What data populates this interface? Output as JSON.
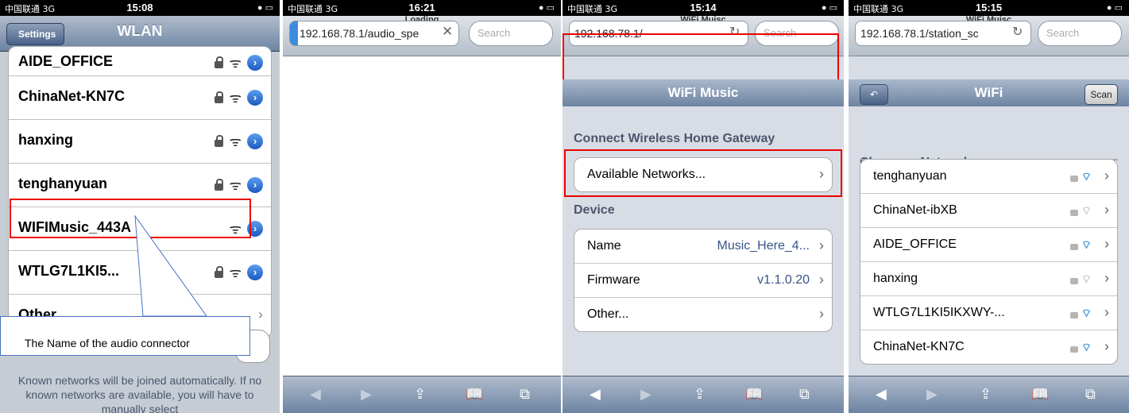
{
  "p1": {
    "status": {
      "carrier": "中国联通 3G",
      "time": "15:08"
    },
    "back": "Settings",
    "title": "WLAN",
    "networks": [
      "AIDE_OFFICE",
      "ChinaNet-KN7C",
      "hanxing",
      "tenghanyuan",
      "WIFIMusic_443A",
      "WTLG7L1KI5..."
    ],
    "other": "Other...",
    "callout": "The Name of the audio connector",
    "footnote": "Known networks will be joined automatically. If no known networks are available, you will have to manually select"
  },
  "p2": {
    "status": {
      "carrier": "中国联通 3G",
      "time": "16:21"
    },
    "page_title": "Loading",
    "url": "192.168.78.1/audio_spe",
    "search_placeholder": "Search"
  },
  "p3": {
    "status": {
      "carrier": "中国联通 3G",
      "time": "15:14"
    },
    "page_title": "WiFi Muisc",
    "url": "192.168.78.1/",
    "search_placeholder": "Search",
    "header": "WiFi Music",
    "section1": "Connect Wireless Home Gateway",
    "available": "Available Networks...",
    "section2": "Device",
    "device": [
      {
        "label": "Name",
        "value": "Music_Here_4..."
      },
      {
        "label": "Firmware",
        "value": "v1.1.0.20"
      },
      {
        "label": "Other...",
        "value": ""
      }
    ]
  },
  "p4": {
    "status": {
      "carrier": "中国联通 3G",
      "time": "15:15"
    },
    "page_title": "WiFi Muisc",
    "url": "192.168.78.1/station_sc",
    "search_placeholder": "Search",
    "header": "WiFi",
    "scan": "Scan",
    "section": "Choose a Network...",
    "networks": [
      "tenghanyuan",
      "ChinaNet-ibXB",
      "AIDE_OFFICE",
      "hanxing",
      "WTLG7L1KI5IKXWY-...",
      "ChinaNet-KN7C"
    ]
  },
  "colors": {
    "highlight": "#e00000",
    "link": "#385487",
    "nav": "#6d84a2"
  }
}
